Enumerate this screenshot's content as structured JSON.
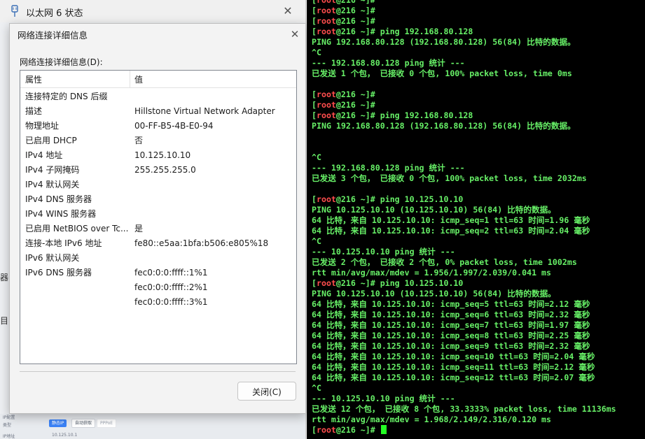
{
  "background_window": {
    "title": "以太网 6 状态",
    "close_glyph": "✕",
    "edge_text_1": "器",
    "edge_text_2": "目",
    "panel": {
      "label1": "IP配置",
      "label2": "类型",
      "label3": "IP地址",
      "btn1": "静态IP",
      "btn2": "自动获取",
      "btn3": "PPPoE",
      "value": "10.125.10.1"
    }
  },
  "dialog": {
    "title": "网络连接详细信息",
    "close_glyph": "✕",
    "list_label": "网络连接详细信息(D):",
    "columns": {
      "property": "属性",
      "value": "值"
    },
    "rows": [
      {
        "property": "连接特定的 DNS 后缀",
        "value": ""
      },
      {
        "property": "描述",
        "value": "Hillstone Virtual Network Adapter"
      },
      {
        "property": "物理地址",
        "value": "00-FF-B5-4B-E0-94"
      },
      {
        "property": "已启用 DHCP",
        "value": "否"
      },
      {
        "property": "IPv4 地址",
        "value": "10.125.10.10"
      },
      {
        "property": "IPv4 子网掩码",
        "value": "255.255.255.0"
      },
      {
        "property": "IPv4 默认网关",
        "value": ""
      },
      {
        "property": "IPv4 DNS 服务器",
        "value": ""
      },
      {
        "property": "IPv4 WINS 服务器",
        "value": ""
      },
      {
        "property": "已启用 NetBIOS over Tc...",
        "value": "是"
      },
      {
        "property": "连接-本地 IPv6 地址",
        "value": "fe80::e5aa:1bfa:b506:e805%18"
      },
      {
        "property": "IPv6 默认网关",
        "value": ""
      },
      {
        "property": "IPv6 DNS 服务器",
        "value": "fec0:0:0:ffff::1%1"
      },
      {
        "property": "",
        "value": "fec0:0:0:ffff::2%1"
      },
      {
        "property": "",
        "value": "fec0:0:0:ffff::3%1"
      }
    ],
    "close_button": "关闭(C)"
  },
  "terminal": {
    "lines": [
      {
        "type": "prompt",
        "cmd": ""
      },
      {
        "type": "prompt",
        "cmd": ""
      },
      {
        "type": "prompt",
        "cmd": ""
      },
      {
        "type": "prompt",
        "cmd": "ping 192.168.80.128"
      },
      {
        "type": "text",
        "text": "PING 192.168.80.128 (192.168.80.128) 56(84) 比特的数据。"
      },
      {
        "type": "text",
        "text": "^C"
      },
      {
        "type": "text",
        "text": "--- 192.168.80.128 ping 统计 ---"
      },
      {
        "type": "text",
        "text": "已发送 1 个包， 已接收 0 个包, 100% packet loss, time 0ms"
      },
      {
        "type": "text",
        "text": ""
      },
      {
        "type": "prompt",
        "cmd": ""
      },
      {
        "type": "prompt",
        "cmd": ""
      },
      {
        "type": "prompt",
        "cmd": "ping 192.168.80.128"
      },
      {
        "type": "text",
        "text": "PING 192.168.80.128 (192.168.80.128) 56(84) 比特的数据。"
      },
      {
        "type": "text",
        "text": ""
      },
      {
        "type": "text",
        "text": ""
      },
      {
        "type": "text",
        "text": "^C"
      },
      {
        "type": "text",
        "text": "--- 192.168.80.128 ping 统计 ---"
      },
      {
        "type": "text",
        "text": "已发送 3 个包， 已接收 0 个包, 100% packet loss, time 2032ms"
      },
      {
        "type": "text",
        "text": ""
      },
      {
        "type": "prompt",
        "cmd": "ping 10.125.10.10"
      },
      {
        "type": "text",
        "text": "PING 10.125.10.10 (10.125.10.10) 56(84) 比特的数据。"
      },
      {
        "type": "text",
        "text": "64 比特，来自 10.125.10.10: icmp_seq=1 ttl=63 时间=1.96 毫秒"
      },
      {
        "type": "text",
        "text": "64 比特，来自 10.125.10.10: icmp_seq=2 ttl=63 时间=2.04 毫秒"
      },
      {
        "type": "text",
        "text": "^C"
      },
      {
        "type": "text",
        "text": "--- 10.125.10.10 ping 统计 ---"
      },
      {
        "type": "text",
        "text": "已发送 2 个包， 已接收 2 个包, 0% packet loss, time 1002ms"
      },
      {
        "type": "text",
        "text": "rtt min/avg/max/mdev = 1.956/1.997/2.039/0.041 ms"
      },
      {
        "type": "prompt",
        "cmd": "ping 10.125.10.10"
      },
      {
        "type": "text",
        "text": "PING 10.125.10.10 (10.125.10.10) 56(84) 比特的数据。"
      },
      {
        "type": "text",
        "text": "64 比特，来自 10.125.10.10: icmp_seq=5 ttl=63 时间=2.12 毫秒"
      },
      {
        "type": "text",
        "text": "64 比特，来自 10.125.10.10: icmp_seq=6 ttl=63 时间=2.32 毫秒"
      },
      {
        "type": "text",
        "text": "64 比特，来自 10.125.10.10: icmp_seq=7 ttl=63 时间=1.97 毫秒"
      },
      {
        "type": "text",
        "text": "64 比特，来自 10.125.10.10: icmp_seq=8 ttl=63 时间=2.25 毫秒"
      },
      {
        "type": "text",
        "text": "64 比特，来自 10.125.10.10: icmp_seq=9 ttl=63 时间=2.32 毫秒"
      },
      {
        "type": "text",
        "text": "64 比特，来自 10.125.10.10: icmp_seq=10 ttl=63 时间=2.04 毫秒"
      },
      {
        "type": "text",
        "text": "64 比特，来自 10.125.10.10: icmp_seq=11 ttl=63 时间=2.12 毫秒"
      },
      {
        "type": "text",
        "text": "64 比特，来自 10.125.10.10: icmp_seq=12 ttl=63 时间=2.07 毫秒"
      },
      {
        "type": "text",
        "text": "^C"
      },
      {
        "type": "text",
        "text": "--- 10.125.10.10 ping 统计 ---"
      },
      {
        "type": "text",
        "text": "已发送 12 个包， 已接收 8 个包, 33.3333% packet loss, time 11136ms"
      },
      {
        "type": "text",
        "text": "rtt min/avg/max/mdev = 1.968/2.149/2.316/0.120 ms"
      },
      {
        "type": "prompt",
        "cmd": "",
        "cursor": true
      }
    ],
    "prompt": {
      "open": "[",
      "user": "root",
      "rest": "@216 ~]# "
    },
    "colors": {
      "text": "#67f067",
      "user": "#ff4d4d",
      "cursor": "#24ff24",
      "background": "#000000"
    }
  }
}
